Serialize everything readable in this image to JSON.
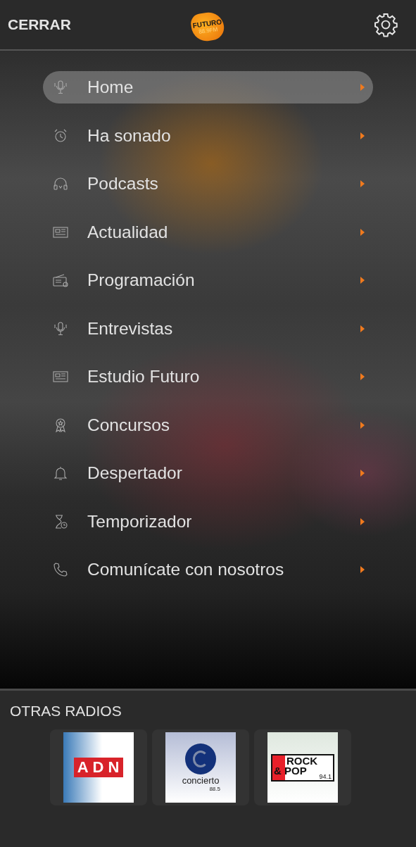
{
  "header": {
    "close_label": "CERRAR",
    "logo": {
      "name": "FUTURO",
      "frequency": "88.9FM"
    }
  },
  "menu": [
    {
      "label": "Home",
      "selected": true
    },
    {
      "label": "Ha sonado",
      "selected": false
    },
    {
      "label": "Podcasts",
      "selected": false
    },
    {
      "label": "Actualidad",
      "selected": false
    },
    {
      "label": "Programación",
      "selected": false
    },
    {
      "label": "Entrevistas",
      "selected": false
    },
    {
      "label": "Estudio Futuro",
      "selected": false
    },
    {
      "label": "Concursos",
      "selected": false
    },
    {
      "label": "Despertador",
      "selected": false
    },
    {
      "label": "Temporizador",
      "selected": false
    },
    {
      "label": "Comunícate con nosotros",
      "selected": false
    }
  ],
  "other_radios": {
    "title": "OTRAS RADIOS",
    "stations": [
      {
        "kind": "adn",
        "logo_text": "ADN"
      },
      {
        "kind": "concierto",
        "logo_text": "concierto",
        "frequency": "88.5"
      },
      {
        "kind": "rockpop",
        "logo_text": "ROCK",
        "logo_text_2": "& POP",
        "frequency": "94.1"
      }
    ]
  }
}
